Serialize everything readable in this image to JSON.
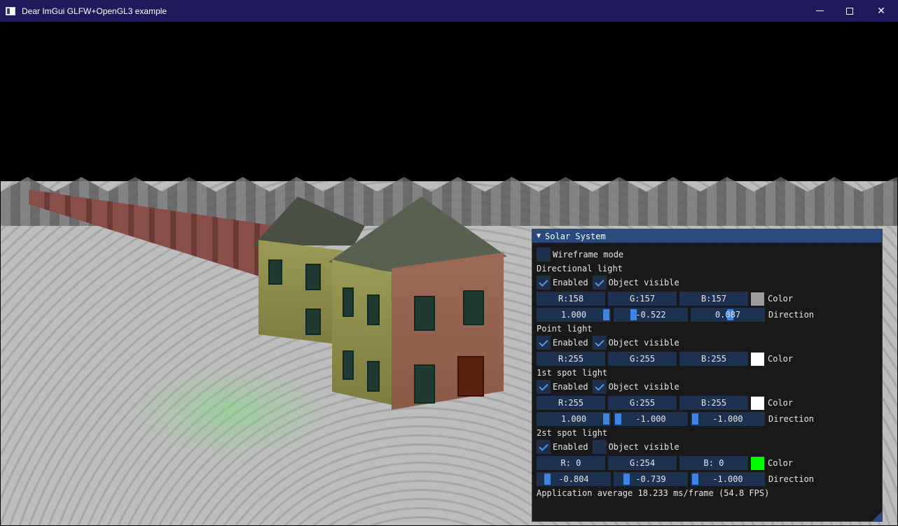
{
  "window": {
    "title": "Dear ImGui GLFW+OpenGL3 example",
    "controls": {
      "minimize": "minimize-icon",
      "maximize": "maximize-icon",
      "close": "close-icon"
    }
  },
  "panel": {
    "title": "Solar System",
    "wireframe": {
      "label": "Wireframe mode",
      "checked": false
    },
    "directional": {
      "heading": "Directional light",
      "enabled": {
        "label": "Enabled",
        "checked": true
      },
      "visible": {
        "label": "Object visible",
        "checked": true
      },
      "rgb": {
        "r": "R:158",
        "g": "G:157",
        "b": "B:157"
      },
      "color_label": "Color",
      "swatch": "#9e9d9d",
      "direction": [
        "1.000",
        "-0.522",
        "0.087"
      ],
      "direction_label": "Direction"
    },
    "point": {
      "heading": "Point light",
      "enabled": {
        "label": "Enabled",
        "checked": true
      },
      "visible": {
        "label": "Object visible",
        "checked": true
      },
      "rgb": {
        "r": "R:255",
        "g": "G:255",
        "b": "B:255"
      },
      "color_label": "Color",
      "swatch": "#ffffff"
    },
    "spot1": {
      "heading": "1st spot light",
      "enabled": {
        "label": "Enabled",
        "checked": true
      },
      "visible": {
        "label": "Object visible",
        "checked": true
      },
      "rgb": {
        "r": "R:255",
        "g": "G:255",
        "b": "B:255"
      },
      "color_label": "Color",
      "swatch": "#ffffff",
      "direction": [
        "1.000",
        "-1.000",
        "-1.000"
      ],
      "direction_label": "Direction"
    },
    "spot2": {
      "heading": "2st spot light",
      "enabled": {
        "label": "Enabled",
        "checked": true
      },
      "visible": {
        "label": "Object visible",
        "checked": false
      },
      "rgb": {
        "r": "R:  0",
        "g": "G:254",
        "b": "B:  0"
      },
      "color_label": "Color",
      "swatch": "#00fe00",
      "direction": [
        "-0.804",
        "-0.739",
        "-1.000"
      ],
      "direction_label": "Direction"
    },
    "fps_text": "Application average 18.233 ms/frame (54.8 FPS)"
  }
}
